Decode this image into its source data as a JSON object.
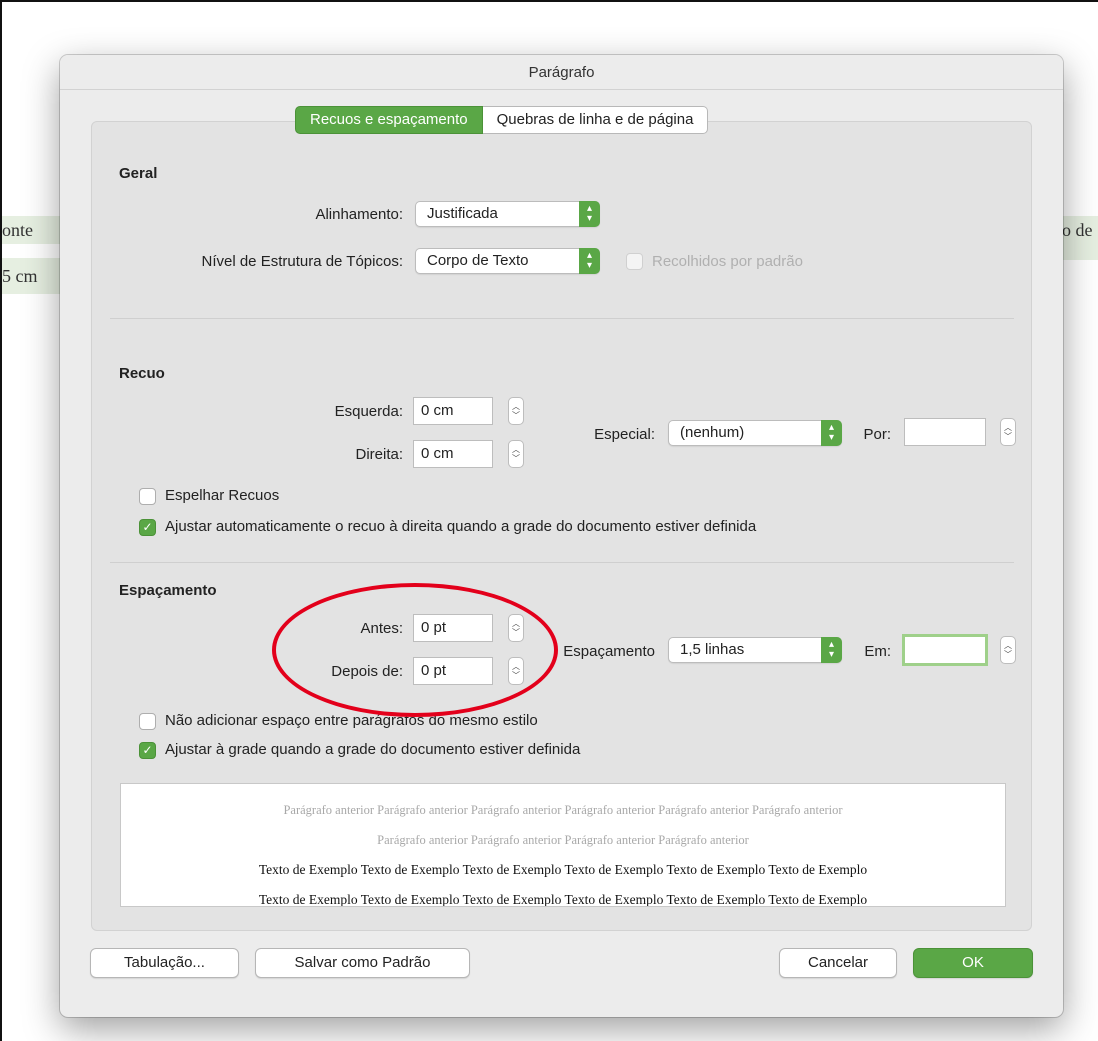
{
  "background_doc": {
    "left_line1": "onte",
    "left_line2": "5 cm",
    "right_line1": "o de"
  },
  "dialog": {
    "title": "Parágrafo",
    "tabs": [
      "Recuos e espaçamento",
      "Quebras de linha e de página"
    ],
    "active_tab": "Recuos e espaçamento",
    "geral": {
      "title": "Geral",
      "alinhamento_label": "Alinhamento:",
      "alinhamento_value": "Justificada",
      "nivel_label": "Nível de Estrutura de Tópicos:",
      "nivel_value": "Corpo de Texto",
      "recolhidos_label": "Recolhidos por padrão",
      "recolhidos_checked": false
    },
    "recuo": {
      "title": "Recuo",
      "esquerda_label": "Esquerda:",
      "esquerda_value": "0 cm",
      "direita_label": "Direita:",
      "direita_value": "0 cm",
      "especial_label": "Especial:",
      "especial_value": "(nenhum)",
      "por_label": "Por:",
      "por_value": "",
      "espelhar_label": "Espelhar Recuos",
      "espelhar_checked": false,
      "ajustar_label": "Ajustar automaticamente o recuo à direita quando a grade do documento estiver definida",
      "ajustar_checked": true
    },
    "espacamento": {
      "title": "Espaçamento",
      "antes_label": "Antes:",
      "antes_value": "0 pt",
      "depois_label": "Depois de:",
      "depois_value": "0 pt",
      "espacamento_label": "Espaçamento",
      "espacamento_value": "1,5 linhas",
      "em_label": "Em:",
      "em_value": "",
      "nao_adicionar_label": "Não adicionar espaço entre parágrafos do mesmo estilo",
      "nao_adicionar_checked": false,
      "ajustar_grade_label": "Ajustar à grade quando a grade do documento estiver definida",
      "ajustar_grade_checked": true
    },
    "preview": {
      "light_line1": "Parágrafo anterior Parágrafo anterior Parágrafo anterior Parágrafo anterior Parágrafo anterior Parágrafo anterior",
      "light_line2": "Parágrafo anterior Parágrafo anterior Parágrafo anterior Parágrafo anterior",
      "dark_line1": "Texto de Exemplo Texto de Exemplo Texto de Exemplo Texto de Exemplo Texto de Exemplo Texto de Exemplo",
      "dark_line2": "Texto de Exemplo Texto de Exemplo Texto de Exemplo Texto de Exemplo Texto de Exemplo Texto de Exemplo"
    },
    "buttons": {
      "tabulacao": "Tabulação...",
      "salvar_padrao": "Salvar como Padrão",
      "cancelar": "Cancelar",
      "ok": "OK"
    }
  },
  "colors": {
    "accent": "#5aa746",
    "annotation": "#e3001b",
    "dialog_bg": "#ececec"
  }
}
